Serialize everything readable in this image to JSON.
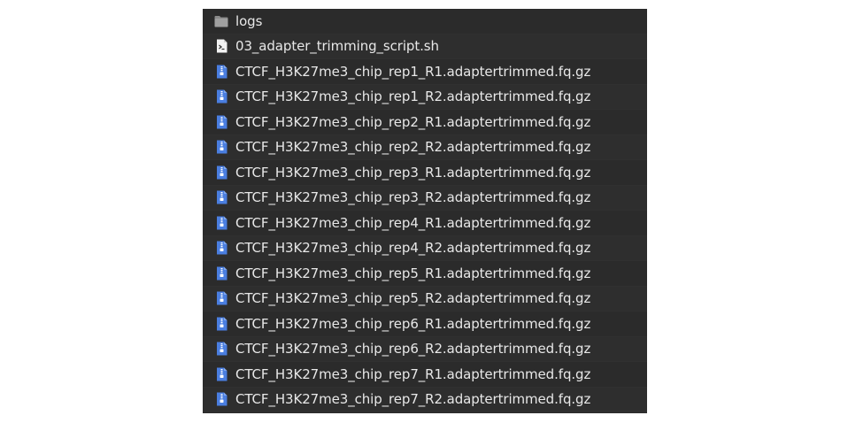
{
  "files": [
    {
      "name": "logs",
      "icon": "folder-icon"
    },
    {
      "name": "03_adapter_trimming_script.sh",
      "icon": "script-file-icon"
    },
    {
      "name": "CTCF_H3K27me3_chip_rep1_R1.adaptertrimmed.fq.gz",
      "icon": "archive-file-icon"
    },
    {
      "name": "CTCF_H3K27me3_chip_rep1_R2.adaptertrimmed.fq.gz",
      "icon": "archive-file-icon"
    },
    {
      "name": "CTCF_H3K27me3_chip_rep2_R1.adaptertrimmed.fq.gz",
      "icon": "archive-file-icon"
    },
    {
      "name": "CTCF_H3K27me3_chip_rep2_R2.adaptertrimmed.fq.gz",
      "icon": "archive-file-icon"
    },
    {
      "name": "CTCF_H3K27me3_chip_rep3_R1.adaptertrimmed.fq.gz",
      "icon": "archive-file-icon"
    },
    {
      "name": "CTCF_H3K27me3_chip_rep3_R2.adaptertrimmed.fq.gz",
      "icon": "archive-file-icon"
    },
    {
      "name": "CTCF_H3K27me3_chip_rep4_R1.adaptertrimmed.fq.gz",
      "icon": "archive-file-icon"
    },
    {
      "name": "CTCF_H3K27me3_chip_rep4_R2.adaptertrimmed.fq.gz",
      "icon": "archive-file-icon"
    },
    {
      "name": "CTCF_H3K27me3_chip_rep5_R1.adaptertrimmed.fq.gz",
      "icon": "archive-file-icon"
    },
    {
      "name": "CTCF_H3K27me3_chip_rep5_R2.adaptertrimmed.fq.gz",
      "icon": "archive-file-icon"
    },
    {
      "name": "CTCF_H3K27me3_chip_rep6_R1.adaptertrimmed.fq.gz",
      "icon": "archive-file-icon"
    },
    {
      "name": "CTCF_H3K27me3_chip_rep6_R2.adaptertrimmed.fq.gz",
      "icon": "archive-file-icon"
    },
    {
      "name": "CTCF_H3K27me3_chip_rep7_R1.adaptertrimmed.fq.gz",
      "icon": "archive-file-icon"
    },
    {
      "name": "CTCF_H3K27me3_chip_rep7_R2.adaptertrimmed.fq.gz",
      "icon": "archive-file-icon"
    }
  ],
  "colors": {
    "panel_background": "#2b2b2b",
    "text": "#e8e8e8",
    "folder": "#8c8c8c",
    "archive": "#4a7ee0"
  }
}
